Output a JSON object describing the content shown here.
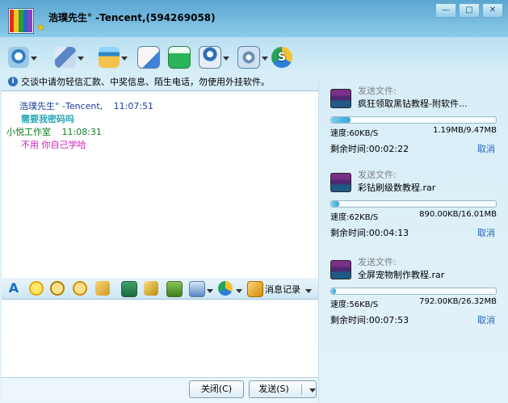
{
  "window": {
    "title": "浩璞先生° -Tencent,(594269058)",
    "controls": {
      "minimize": "—",
      "maximize": "□",
      "close": "✕"
    }
  },
  "toolbar": [
    {
      "name": "video-call",
      "icon": "webcam-icon",
      "dropdown": true
    },
    {
      "name": "voice",
      "icon": "microphone-icon",
      "dropdown": true
    },
    {
      "name": "send-file",
      "icon": "folder-share-icon",
      "dropdown": true
    },
    {
      "name": "mail",
      "icon": "mail-icon",
      "dropdown": false
    },
    {
      "name": "add-contact",
      "icon": "add-icon",
      "dropdown": false
    },
    {
      "name": "user-info",
      "icon": "profile-icon",
      "dropdown": true
    },
    {
      "name": "settings",
      "icon": "settings-icon",
      "dropdown": true
    },
    {
      "name": "tenpay",
      "icon": "tenpay-icon",
      "dropdown": false
    }
  ],
  "notice": {
    "text": "交谈中请勿轻信汇款、中奖信息、陌生电话，勿使用外挂软件。"
  },
  "chat": [
    {
      "sender": "浩璞先生° -Tencent,",
      "time": "11:07:51",
      "content": "需要我密码吗",
      "sender_color": "#1b3c9c",
      "content_color": "#2aa7b8"
    },
    {
      "sender": "小悦工作室",
      "time": "11:08:31",
      "content": "不用  你自己学哈",
      "sender_color": "#0f7a20",
      "content_color": "#d21cbf"
    }
  ],
  "format_toolbar": {
    "history_label": "消息记录"
  },
  "buttons": {
    "close": "关闭(C)",
    "send": "发送(S)"
  },
  "transfers": [
    {
      "label": "发送文件:",
      "filename": "疯狂领取黑钻教程-附软件...",
      "progress": 0.12,
      "speed": "速度:60KB/S",
      "size": "1.19MB/9.47MB",
      "remaining": "剩余时间:00:02:22",
      "cancel": "取消"
    },
    {
      "label": "发送文件:",
      "filename": "彩钻刷级数教程.rar",
      "progress": 0.05,
      "speed": "速度:62KB/S",
      "size": "890.00KB/16.01MB",
      "remaining": "剩余时间:00:04:13",
      "cancel": "取消"
    },
    {
      "label": "发送文件:",
      "filename": "全屏宠物制作教程.rar",
      "progress": 0.03,
      "speed": "速度:56KB/S",
      "size": "792.00KB/26.32MB",
      "remaining": "剩余时间:00:07:53",
      "cancel": "取消"
    }
  ],
  "colors": {
    "title_bar": "#5aa6d2",
    "progress_fill": "#2fa3d4",
    "link": "#1c66c2"
  }
}
